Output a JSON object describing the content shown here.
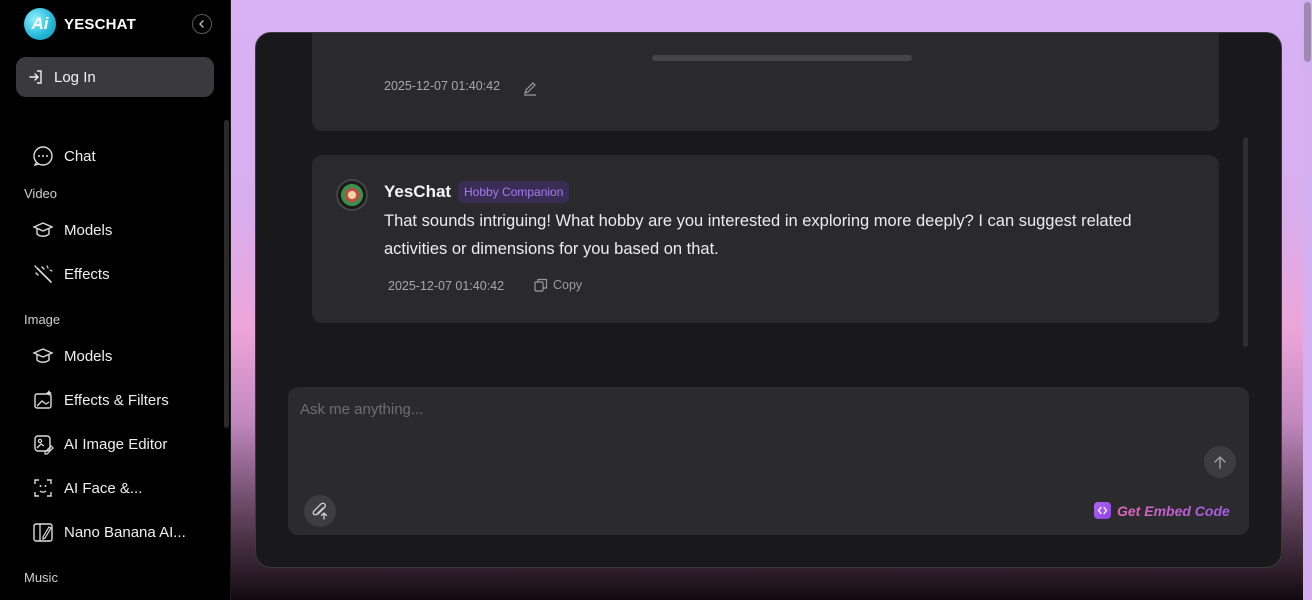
{
  "app": {
    "brand_name": "YESCHAT",
    "logo_text": "Ai"
  },
  "sidebar": {
    "login_label": "Log In",
    "items": [
      {
        "label": "Chat",
        "icon": "chat-bubble-icon"
      },
      {
        "label": "Models",
        "icon": "graduation-cap-icon"
      },
      {
        "label": "Effects",
        "icon": "magic-wand-icon"
      },
      {
        "label": "Models",
        "icon": "graduation-cap-icon"
      },
      {
        "label": "Effects & Filters",
        "icon": "image-sparkle-icon"
      },
      {
        "label": "AI Image Editor",
        "icon": "image-edit-icon"
      },
      {
        "label": "AI Face &...",
        "icon": "face-scan-icon"
      },
      {
        "label": "Nano Banana AI...",
        "icon": "pen-frame-icon"
      }
    ],
    "sections": {
      "video": "Video",
      "image": "Image",
      "music": "Music"
    }
  },
  "conversation": {
    "user_message": {
      "timestamp": "2025-12-07 01:40:42"
    },
    "bot_message": {
      "name": "YesChat",
      "badge": "Hobby Companion",
      "text": "That sounds intriguing! What hobby are you interested in exploring more deeply? I can suggest related activities or dimensions for you based on that.",
      "timestamp": "2025-12-07 01:40:42",
      "copy_label": "Copy"
    }
  },
  "composer": {
    "placeholder": "Ask me anything...",
    "embed_label": "Get Embed Code"
  }
}
